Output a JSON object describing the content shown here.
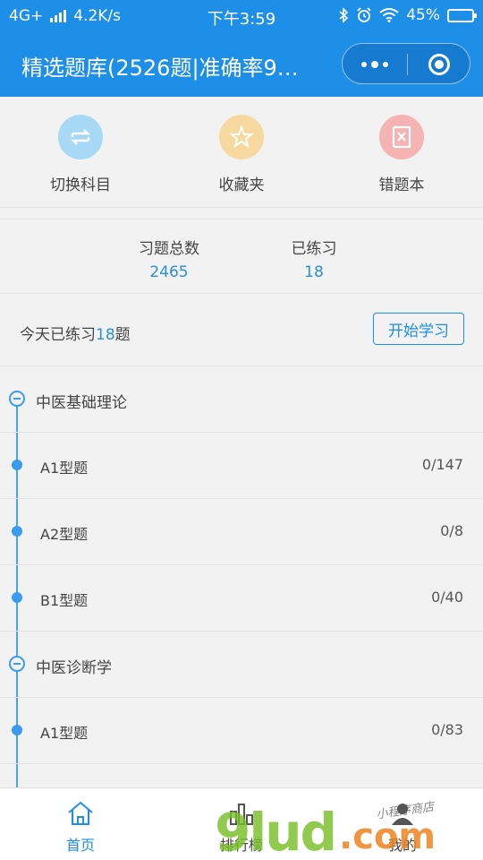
{
  "status_bar": {
    "network": "4G+",
    "speed": "4.2K/s",
    "time": "下午3:59",
    "battery": "45%"
  },
  "header": {
    "title": "精选题库(2526题|准确率9…"
  },
  "quick_actions": [
    {
      "label": "切换科目",
      "icon": "switch-icon",
      "color": "#a7d8f5"
    },
    {
      "label": "收藏夹",
      "icon": "star-icon",
      "color": "#f7d9a0"
    },
    {
      "label": "错题本",
      "icon": "wrong-book-icon",
      "color": "#f5b3b3"
    }
  ],
  "stats": [
    {
      "label": "习题总数",
      "value": "2465"
    },
    {
      "label": "已练习",
      "value": "18"
    }
  ],
  "today": {
    "prefix": "今天已练习",
    "count": "18",
    "suffix": "题",
    "button": "开始学习"
  },
  "categories": [
    {
      "name": "中医基础理论",
      "items": [
        {
          "name": "A1型题",
          "count": "0/147"
        },
        {
          "name": "A2型题",
          "count": "0/8"
        },
        {
          "name": "B1型题",
          "count": "0/40"
        }
      ]
    },
    {
      "name": "中医诊断学",
      "items": [
        {
          "name": "A1型题",
          "count": "0/83"
        }
      ]
    }
  ],
  "tabbar": [
    {
      "label": "首页",
      "icon": "home-icon",
      "active": true
    },
    {
      "label": "排行榜",
      "icon": "ranking-icon",
      "active": false
    },
    {
      "label": "我的",
      "icon": "user-icon",
      "active": false
    }
  ],
  "watermark": {
    "main": "9lud",
    "suffix": ".com",
    "small": "小程序商店"
  },
  "colors": {
    "primary": "#1e8fe8",
    "accent_text": "#2a8fd6",
    "background": "#f2f2f2"
  }
}
